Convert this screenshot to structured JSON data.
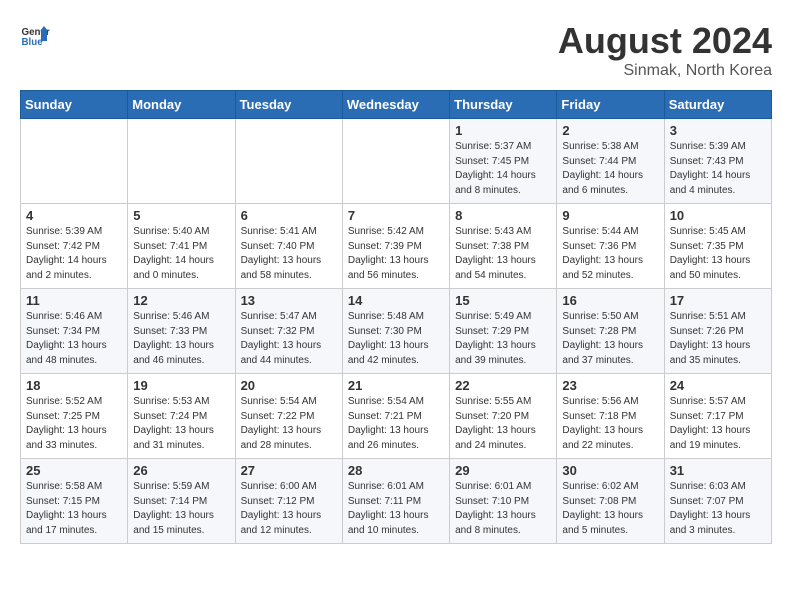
{
  "header": {
    "logo_general": "General",
    "logo_blue": "Blue",
    "month_year": "August 2024",
    "location": "Sinmak, North Korea"
  },
  "weekdays": [
    "Sunday",
    "Monday",
    "Tuesday",
    "Wednesday",
    "Thursday",
    "Friday",
    "Saturday"
  ],
  "weeks": [
    [
      {
        "day": "",
        "info": ""
      },
      {
        "day": "",
        "info": ""
      },
      {
        "day": "",
        "info": ""
      },
      {
        "day": "",
        "info": ""
      },
      {
        "day": "1",
        "info": "Sunrise: 5:37 AM\nSunset: 7:45 PM\nDaylight: 14 hours\nand 8 minutes."
      },
      {
        "day": "2",
        "info": "Sunrise: 5:38 AM\nSunset: 7:44 PM\nDaylight: 14 hours\nand 6 minutes."
      },
      {
        "day": "3",
        "info": "Sunrise: 5:39 AM\nSunset: 7:43 PM\nDaylight: 14 hours\nand 4 minutes."
      }
    ],
    [
      {
        "day": "4",
        "info": "Sunrise: 5:39 AM\nSunset: 7:42 PM\nDaylight: 14 hours\nand 2 minutes."
      },
      {
        "day": "5",
        "info": "Sunrise: 5:40 AM\nSunset: 7:41 PM\nDaylight: 14 hours\nand 0 minutes."
      },
      {
        "day": "6",
        "info": "Sunrise: 5:41 AM\nSunset: 7:40 PM\nDaylight: 13 hours\nand 58 minutes."
      },
      {
        "day": "7",
        "info": "Sunrise: 5:42 AM\nSunset: 7:39 PM\nDaylight: 13 hours\nand 56 minutes."
      },
      {
        "day": "8",
        "info": "Sunrise: 5:43 AM\nSunset: 7:38 PM\nDaylight: 13 hours\nand 54 minutes."
      },
      {
        "day": "9",
        "info": "Sunrise: 5:44 AM\nSunset: 7:36 PM\nDaylight: 13 hours\nand 52 minutes."
      },
      {
        "day": "10",
        "info": "Sunrise: 5:45 AM\nSunset: 7:35 PM\nDaylight: 13 hours\nand 50 minutes."
      }
    ],
    [
      {
        "day": "11",
        "info": "Sunrise: 5:46 AM\nSunset: 7:34 PM\nDaylight: 13 hours\nand 48 minutes."
      },
      {
        "day": "12",
        "info": "Sunrise: 5:46 AM\nSunset: 7:33 PM\nDaylight: 13 hours\nand 46 minutes."
      },
      {
        "day": "13",
        "info": "Sunrise: 5:47 AM\nSunset: 7:32 PM\nDaylight: 13 hours\nand 44 minutes."
      },
      {
        "day": "14",
        "info": "Sunrise: 5:48 AM\nSunset: 7:30 PM\nDaylight: 13 hours\nand 42 minutes."
      },
      {
        "day": "15",
        "info": "Sunrise: 5:49 AM\nSunset: 7:29 PM\nDaylight: 13 hours\nand 39 minutes."
      },
      {
        "day": "16",
        "info": "Sunrise: 5:50 AM\nSunset: 7:28 PM\nDaylight: 13 hours\nand 37 minutes."
      },
      {
        "day": "17",
        "info": "Sunrise: 5:51 AM\nSunset: 7:26 PM\nDaylight: 13 hours\nand 35 minutes."
      }
    ],
    [
      {
        "day": "18",
        "info": "Sunrise: 5:52 AM\nSunset: 7:25 PM\nDaylight: 13 hours\nand 33 minutes."
      },
      {
        "day": "19",
        "info": "Sunrise: 5:53 AM\nSunset: 7:24 PM\nDaylight: 13 hours\nand 31 minutes."
      },
      {
        "day": "20",
        "info": "Sunrise: 5:54 AM\nSunset: 7:22 PM\nDaylight: 13 hours\nand 28 minutes."
      },
      {
        "day": "21",
        "info": "Sunrise: 5:54 AM\nSunset: 7:21 PM\nDaylight: 13 hours\nand 26 minutes."
      },
      {
        "day": "22",
        "info": "Sunrise: 5:55 AM\nSunset: 7:20 PM\nDaylight: 13 hours\nand 24 minutes."
      },
      {
        "day": "23",
        "info": "Sunrise: 5:56 AM\nSunset: 7:18 PM\nDaylight: 13 hours\nand 22 minutes."
      },
      {
        "day": "24",
        "info": "Sunrise: 5:57 AM\nSunset: 7:17 PM\nDaylight: 13 hours\nand 19 minutes."
      }
    ],
    [
      {
        "day": "25",
        "info": "Sunrise: 5:58 AM\nSunset: 7:15 PM\nDaylight: 13 hours\nand 17 minutes."
      },
      {
        "day": "26",
        "info": "Sunrise: 5:59 AM\nSunset: 7:14 PM\nDaylight: 13 hours\nand 15 minutes."
      },
      {
        "day": "27",
        "info": "Sunrise: 6:00 AM\nSunset: 7:12 PM\nDaylight: 13 hours\nand 12 minutes."
      },
      {
        "day": "28",
        "info": "Sunrise: 6:01 AM\nSunset: 7:11 PM\nDaylight: 13 hours\nand 10 minutes."
      },
      {
        "day": "29",
        "info": "Sunrise: 6:01 AM\nSunset: 7:10 PM\nDaylight: 13 hours\nand 8 minutes."
      },
      {
        "day": "30",
        "info": "Sunrise: 6:02 AM\nSunset: 7:08 PM\nDaylight: 13 hours\nand 5 minutes."
      },
      {
        "day": "31",
        "info": "Sunrise: 6:03 AM\nSunset: 7:07 PM\nDaylight: 13 hours\nand 3 minutes."
      }
    ]
  ]
}
